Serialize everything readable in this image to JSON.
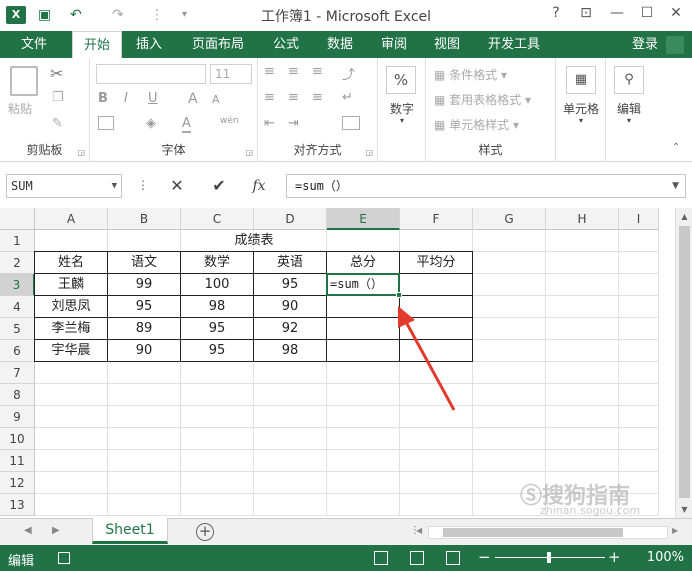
{
  "titlebar": {
    "app_icon": "X",
    "title": "工作簿1 - Microsoft Excel",
    "help": "?",
    "ribbon_display": "⊡",
    "minimize": "—",
    "maximize": "☐",
    "close": "✕",
    "qa_save": "💾",
    "qa_undo": "↶",
    "qa_redo": "↷",
    "qa_custom": "⋮",
    "qa_more": "▾"
  },
  "tabs": {
    "file": "文件",
    "items": [
      "开始",
      "插入",
      "页面布局",
      "公式",
      "数据",
      "审阅",
      "视图",
      "开发工具"
    ],
    "active": "开始",
    "login": "登录"
  },
  "ribbon": {
    "clipboard": {
      "label": "剪贴板",
      "paste": "粘贴"
    },
    "font": {
      "label": "字体",
      "size": "11",
      "bold": "B",
      "italic": "I",
      "underline": "U",
      "grow": "A",
      "shrink": "A",
      "color": "A",
      "wen": "wén"
    },
    "alignment": {
      "label": "对齐方式"
    },
    "number": {
      "label": "数字",
      "icon": "%"
    },
    "styles": {
      "label": "样式",
      "conditional": "条件格式",
      "table": "套用表格格式",
      "cell_styles": "单元格样式"
    },
    "cells": {
      "label": "单元格"
    },
    "editing": {
      "label": "编辑"
    }
  },
  "formula_bar": {
    "name_box": "SUM",
    "cancel": "✕",
    "enter": "✔",
    "fx": "fx",
    "formula": "=sum（）"
  },
  "grid": {
    "columns": [
      "A",
      "B",
      "C",
      "D",
      "E",
      "F",
      "G",
      "H",
      "I"
    ],
    "selected_column": "E",
    "rows": [
      "1",
      "2",
      "3",
      "4",
      "5",
      "6",
      "7",
      "8",
      "9",
      "10",
      "11",
      "12",
      "13"
    ],
    "selected_row": "3",
    "title": "成绩表",
    "headers": [
      "姓名",
      "语文",
      "数学",
      "英语",
      "总分",
      "平均分"
    ],
    "data": [
      [
        "王麟",
        "99",
        "100",
        "95"
      ],
      [
        "刘思凤",
        "95",
        "98",
        "90"
      ],
      [
        "李兰梅",
        "89",
        "95",
        "92"
      ],
      [
        "宇华晨",
        "90",
        "95",
        "98"
      ]
    ],
    "active_cell_value": "=sum（）"
  },
  "sheets": {
    "tabs": [
      "Sheet1"
    ],
    "add": "+"
  },
  "statusbar": {
    "mode": "编辑",
    "zoom_minus": "−",
    "zoom_plus": "+",
    "zoom": "100%"
  },
  "watermark": {
    "text": "搜狗指南",
    "url": "zhinan.sogou.com"
  },
  "colors": {
    "accent": "#217346",
    "arrow": "#e23b2e"
  }
}
